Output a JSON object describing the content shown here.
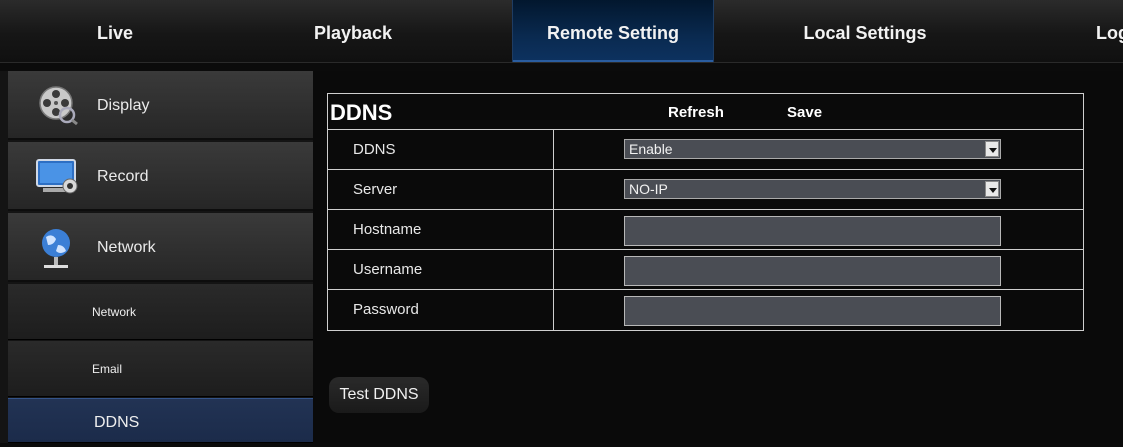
{
  "topnav": {
    "tabs": [
      {
        "label": "Live"
      },
      {
        "label": "Playback"
      },
      {
        "label": "Remote Setting"
      },
      {
        "label": "Local Settings"
      },
      {
        "label": "Log"
      }
    ],
    "active_tab": "Remote Setting"
  },
  "sidebar": {
    "items": [
      {
        "label": "Display",
        "icon": "film-reel-icon"
      },
      {
        "label": "Record",
        "icon": "monitor-icon"
      },
      {
        "label": "Network",
        "icon": "globe-icon"
      }
    ],
    "subitems": [
      {
        "label": "Network"
      },
      {
        "label": "Email"
      },
      {
        "label": "DDNS"
      }
    ],
    "active_subitem": "DDNS"
  },
  "ddns": {
    "title": "DDNS",
    "refresh_label": "Refresh",
    "save_label": "Save",
    "rows": [
      {
        "label": "DDNS",
        "type": "select",
        "value": "Enable"
      },
      {
        "label": "Server",
        "type": "select",
        "value": "NO-IP"
      },
      {
        "label": "Hostname",
        "type": "input",
        "value": ""
      },
      {
        "label": "Username",
        "type": "input",
        "value": ""
      },
      {
        "label": "Password",
        "type": "input",
        "value": ""
      }
    ],
    "test_button_label": "Test DDNS"
  },
  "colors": {
    "active_tab_bg": "#0a2a50",
    "active_subitem_bg": "#1b2b4a",
    "field_bg": "#4a4d54"
  }
}
